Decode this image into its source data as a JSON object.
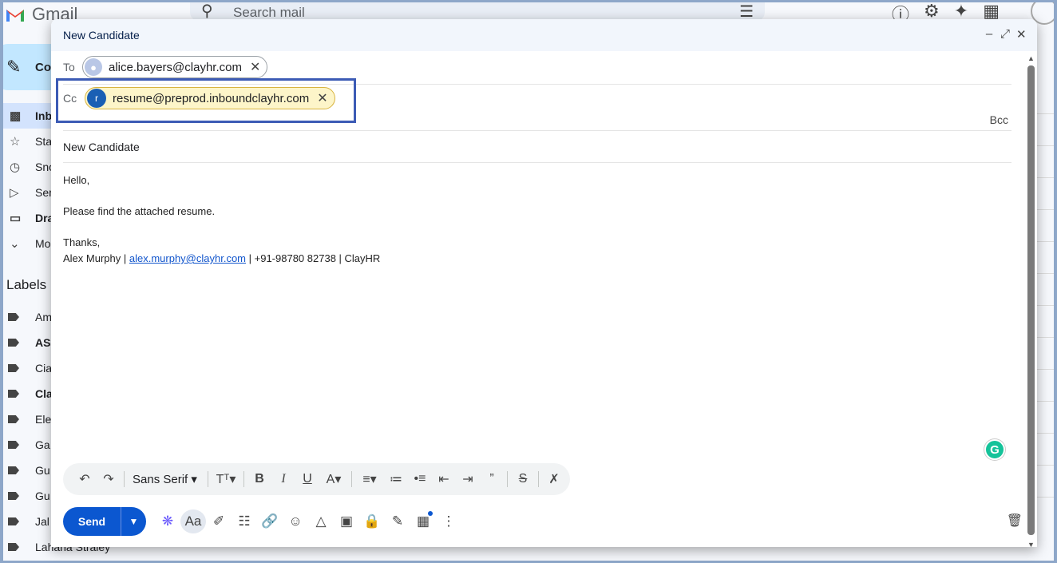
{
  "app": {
    "name": "Gmail"
  },
  "search": {
    "placeholder": "Search mail"
  },
  "sidebar": {
    "compose_label": "Co",
    "items": [
      {
        "label": "Inb",
        "icon": "inbox-icon"
      },
      {
        "label": "Sta",
        "icon": "star-icon"
      },
      {
        "label": "Sno",
        "icon": "clock-icon"
      },
      {
        "label": "Sen",
        "icon": "send-icon"
      },
      {
        "label": "Dra",
        "icon": "draft-icon"
      },
      {
        "label": "Mo",
        "icon": "chevron-down-icon"
      }
    ],
    "labels_title": "Labels",
    "labels": [
      "Am",
      "AS",
      "Cia",
      "Cla",
      "Ele",
      "Ga",
      "Gu",
      "Gu",
      "Jal",
      "Lahana Straley"
    ]
  },
  "compose": {
    "title": "New Candidate",
    "to_label": "To",
    "to_recipient": "alice.bayers@clayhr.com",
    "cc_label": "Cc",
    "cc_recipient": "resume@preprod.inboundclayhr.com",
    "cc_avatar_letter": "r",
    "bcc_label": "Bcc",
    "subject": "New Candidate",
    "body": {
      "greeting": "Hello,",
      "line1": "Please find the attached resume.",
      "thanks": "Thanks,",
      "sig_name": "Alex Murphy |",
      "sig_email": "alex.murphy@clayhr.com",
      "sig_rest": "| +91-98780 82738 | ClayHR"
    },
    "font_name": "Sans Serif",
    "send_label": "Send"
  },
  "colors": {
    "send_button": "#0b57d0",
    "cc_chip_bg": "#fdf5c9",
    "highlight_border": "#3c5bb5",
    "header_bg": "#f2f6fc"
  }
}
